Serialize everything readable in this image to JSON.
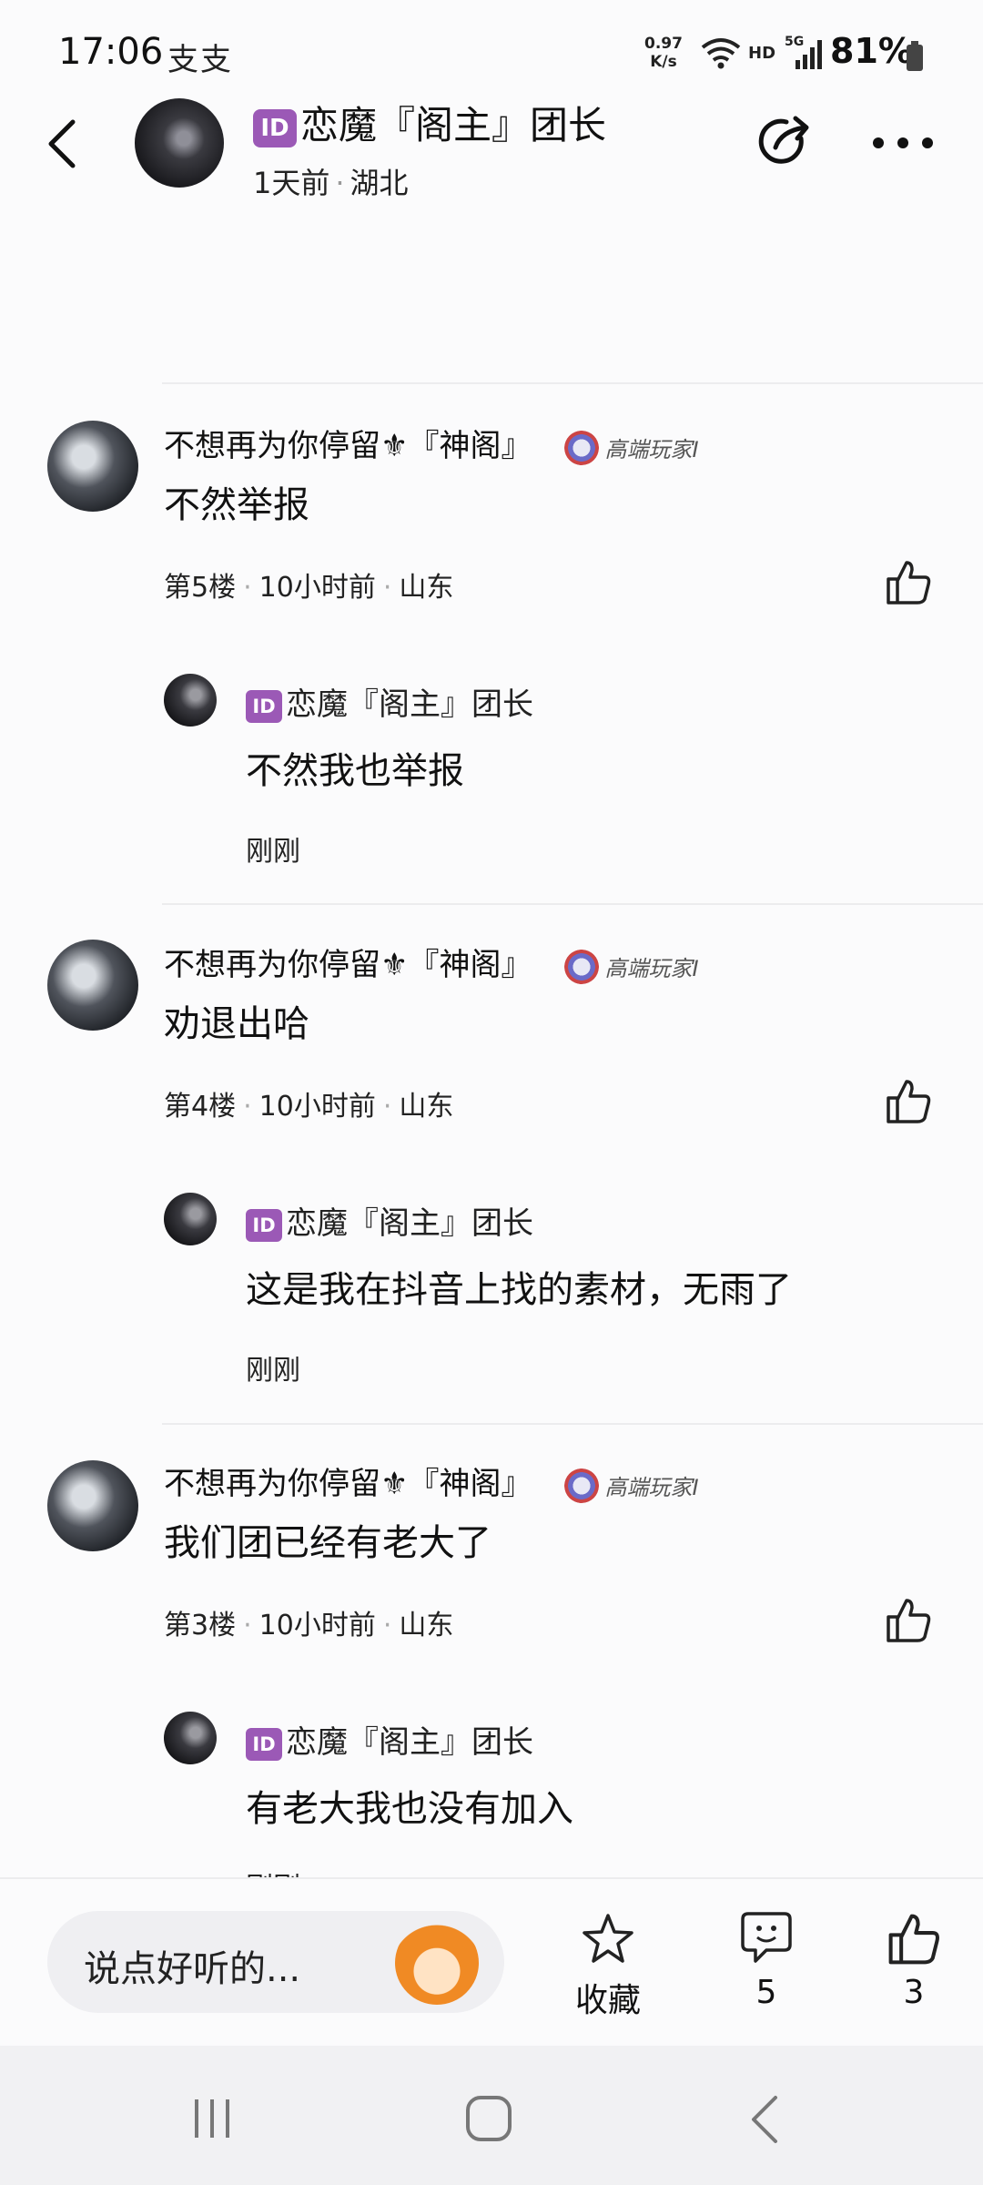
{
  "status_bar": {
    "time": "17:06",
    "notifications": "支支",
    "speed_value": "0.97",
    "speed_unit": "K/s",
    "network": "HD",
    "signal": "5G",
    "battery": "81%"
  },
  "header": {
    "badge": "ID",
    "title": "恋魔『阁主』团长",
    "time_ago": "1天前",
    "location": "湖北"
  },
  "comments": [
    {
      "user": "不想再为你停留⚜『神阁』",
      "rank": "高端玩家I",
      "text": "不然举报",
      "floor": "第5楼",
      "time": "10小时前",
      "location": "山东",
      "reply": {
        "badge": "ID",
        "user": "恋魔『阁主』团长",
        "text": "不然我也举报",
        "time": "刚刚"
      }
    },
    {
      "user": "不想再为你停留⚜『神阁』",
      "rank": "高端玩家I",
      "text": "劝退出哈",
      "floor": "第4楼",
      "time": "10小时前",
      "location": "山东",
      "reply": {
        "badge": "ID",
        "user": "恋魔『阁主』团长",
        "text": "这是我在抖音上找的素材，无雨了",
        "time": "刚刚"
      }
    },
    {
      "user": "不想再为你停留⚜『神阁』",
      "rank": "高端玩家I",
      "text": "我们团已经有老大了",
      "floor": "第3楼",
      "time": "10小时前",
      "location": "山东",
      "reply": {
        "badge": "ID",
        "user": "恋魔『阁主』团长",
        "text": "有老大我也没有加入",
        "time": "刚刚"
      }
    }
  ],
  "bottom_bar": {
    "input_placeholder": "说点好听的...",
    "favorite_label": "收藏",
    "comment_count": "5",
    "like_count": "3"
  },
  "icons": {
    "back": "back-arrow-icon",
    "share": "share-icon",
    "more": "more-dots-icon",
    "like": "thumbs-up-icon",
    "star": "star-icon",
    "comment": "comment-bubble-icon"
  }
}
